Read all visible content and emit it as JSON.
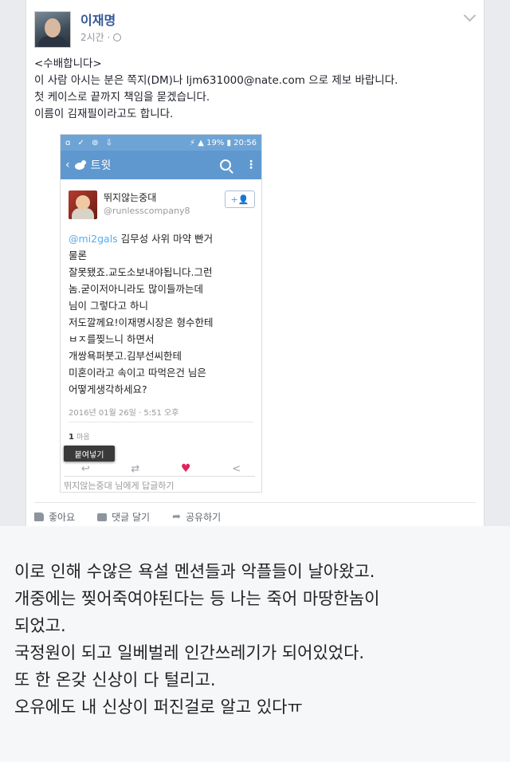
{
  "post": {
    "author": "이재명",
    "time": "2시간 ·",
    "lines": [
      "<수배합니다>",
      "이 사람 아시는 분은 쪽지(DM)나 ljm631000@nate.com 으로 제보 바랍니다.",
      "첫 케이스로 끝까지 책임을 묻겠습니다.",
      "이름이 김재필이라고도 합니다."
    ],
    "actions": {
      "like": "좋아요",
      "comment": "댓글 달기",
      "share": "공유하기"
    }
  },
  "phone": {
    "status_left": "ɑ ✓ ⊚ ⇩",
    "status_right": "⚡ ▲ 19% ▮ 20:56",
    "appbar_title": "트윗",
    "tweet": {
      "name": "뛰지않는중대",
      "handle": "@runlesscompany8",
      "follow": "+👤",
      "mention": "@mi2gals",
      "line1": " 김무성 사위 마약 빤거",
      "lines": [
        "물론",
        "잘못됐죠.교도소보내야됩니다.그런",
        "놈.굳이저아니라도 많이들까는데",
        "님이 그렇다고 하니",
        "저도깔께요!이재명시장은 형수한테",
        "ㅂㅈ를찢느니 하면서",
        "개쌍욕퍼붓고.김부선씨한테",
        "미혼이라고 속이고 따먹은건 님은",
        "어떻게생각하세요?"
      ],
      "date": "2016년 01월 26일 · 5:51 오후",
      "likes_count": "1",
      "likes_label": "마음",
      "paste": "붙여넣기",
      "reply_placeholder": "뛰지않는중대 님에게 답글하기"
    }
  },
  "caption": [
    "이로 인해 수않은 욕설 멘션들과 악플들이 날아왔고.",
    "개중에는 찢어죽여야된다는 등 나는 죽어 마땅한놈이",
    "되었고.",
    "국정원이 되고 일베벌레 인간쓰레기가 되어있었다.",
    "또 한 온갖 신상이 다 털리고.",
    "오유에도 내 신상이 퍼진걸로 알고 있다ㅠ"
  ]
}
